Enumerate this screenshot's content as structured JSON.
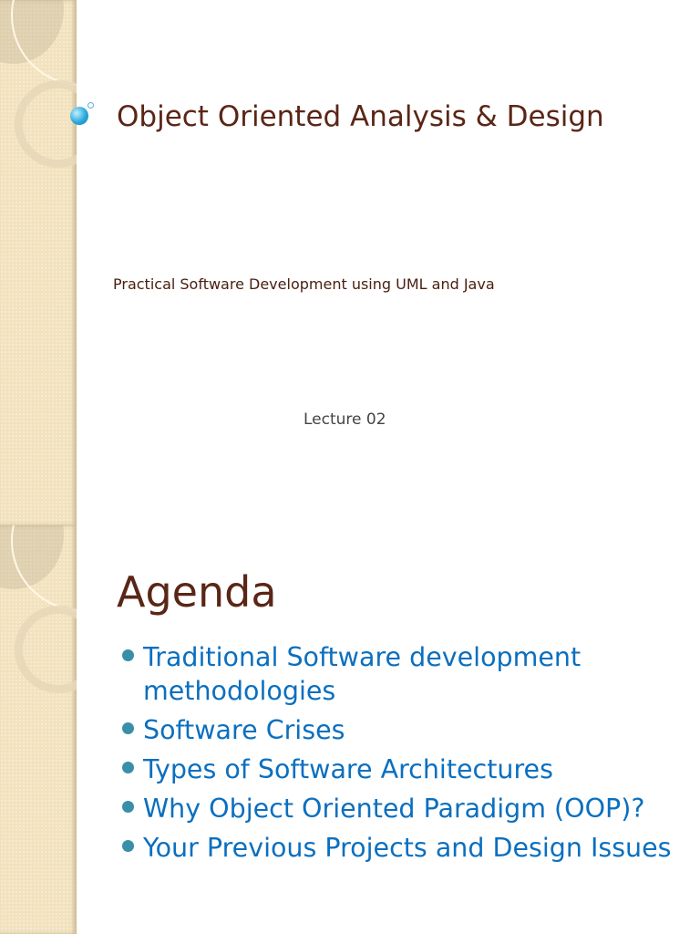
{
  "slide1": {
    "title": "Object Oriented Analysis & Design",
    "subtitle": "Practical Software Development using UML and Java",
    "lecture": "Lecture 02"
  },
  "slide2": {
    "heading": "Agenda",
    "bullets": [
      "Traditional Software development methodologies",
      "Software Crises",
      "Types of Software Architectures",
      "Why Object Oriented Paradigm (OOP)?",
      "Your Previous Projects and Design Issues"
    ]
  },
  "colors": {
    "title": "#5a2616",
    "bullet_text": "#0b6fbf",
    "bullet_dot": "#3a8fa8",
    "sidebar": "#f2e2bd"
  }
}
